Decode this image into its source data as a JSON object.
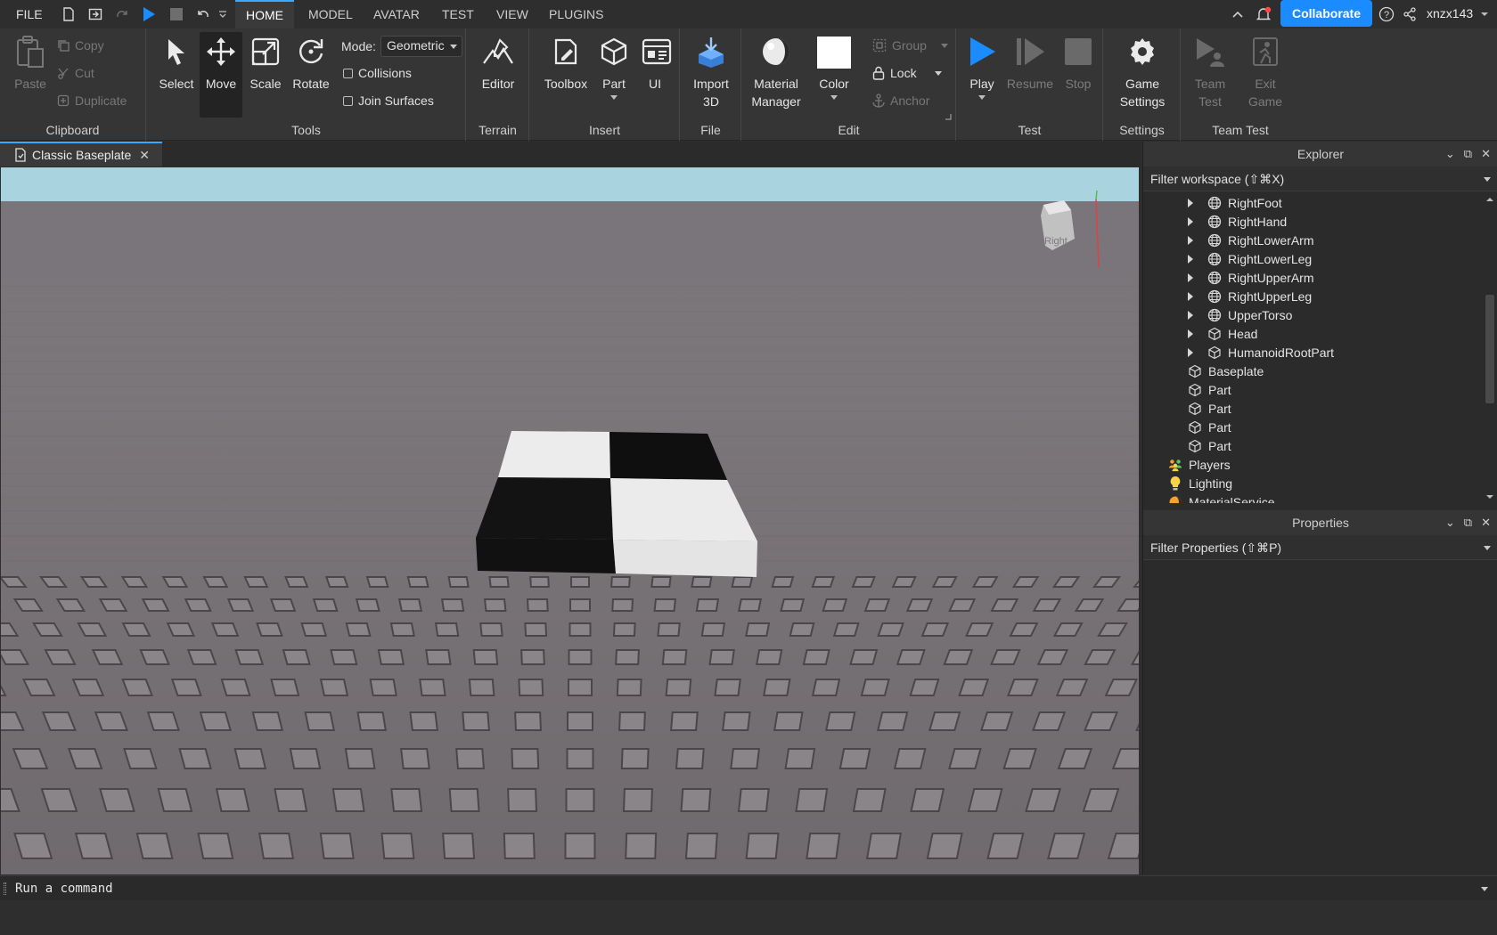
{
  "menubar": {
    "file": "FILE",
    "tabs": [
      "HOME",
      "MODEL",
      "AVATAR",
      "TEST",
      "VIEW",
      "PLUGINS"
    ],
    "active_tab": "HOME",
    "collaborate": "Collaborate",
    "username": "xnzx143"
  },
  "ribbon": {
    "clipboard": {
      "paste": "Paste",
      "copy": "Copy",
      "cut": "Cut",
      "duplicate": "Duplicate",
      "label": "Clipboard"
    },
    "tools": {
      "select": "Select",
      "move": "Move",
      "scale": "Scale",
      "rotate": "Rotate",
      "mode_label": "Mode:",
      "mode_value": "Geometric",
      "collisions": "Collisions",
      "join_surfaces": "Join Surfaces",
      "label": "Tools"
    },
    "terrain": {
      "editor": "Editor",
      "label": "Terrain"
    },
    "insert": {
      "toolbox": "Toolbox",
      "part": "Part",
      "ui": "UI",
      "label": "Insert"
    },
    "file": {
      "import3d_line1": "Import",
      "import3d_line2": "3D",
      "label": "File"
    },
    "edit": {
      "material_line1": "Material",
      "material_line2": "Manager",
      "color": "Color",
      "group": "Group",
      "lock": "Lock",
      "anchor": "Anchor",
      "label": "Edit"
    },
    "test": {
      "play": "Play",
      "resume": "Resume",
      "stop": "Stop",
      "label": "Test"
    },
    "settings": {
      "game_line1": "Game",
      "game_line2": "Settings",
      "label": "Settings"
    },
    "team_test": {
      "team_line1": "Team",
      "team_line2": "Test",
      "exit_line1": "Exit",
      "exit_line2": "Game",
      "label": "Team Test"
    }
  },
  "document": {
    "tab_title": "Classic Baseplate"
  },
  "viewport": {
    "viewcube_face": "Right"
  },
  "explorer": {
    "title": "Explorer",
    "filter_placeholder": "Filter workspace (⇧⌘X)",
    "items": [
      {
        "label": "RightFoot",
        "icon": "meshpart-icon",
        "depth": 2,
        "expandable": true
      },
      {
        "label": "RightHand",
        "icon": "meshpart-icon",
        "depth": 2,
        "expandable": true
      },
      {
        "label": "RightLowerArm",
        "icon": "meshpart-icon",
        "depth": 2,
        "expandable": true
      },
      {
        "label": "RightLowerLeg",
        "icon": "meshpart-icon",
        "depth": 2,
        "expandable": true
      },
      {
        "label": "RightUpperArm",
        "icon": "meshpart-icon",
        "depth": 2,
        "expandable": true
      },
      {
        "label": "RightUpperLeg",
        "icon": "meshpart-icon",
        "depth": 2,
        "expandable": true
      },
      {
        "label": "UpperTorso",
        "icon": "meshpart-icon",
        "depth": 2,
        "expandable": true
      },
      {
        "label": "Head",
        "icon": "part-icon",
        "depth": 2,
        "expandable": true
      },
      {
        "label": "HumanoidRootPart",
        "icon": "part-icon",
        "depth": 2,
        "expandable": true
      },
      {
        "label": "Baseplate",
        "icon": "part-icon",
        "depth": 1,
        "expandable": false
      },
      {
        "label": "Part",
        "icon": "part-icon",
        "depth": 1,
        "expandable": false
      },
      {
        "label": "Part",
        "icon": "part-icon",
        "depth": 1,
        "expandable": false
      },
      {
        "label": "Part",
        "icon": "part-icon",
        "depth": 1,
        "expandable": false
      },
      {
        "label": "Part",
        "icon": "part-icon",
        "depth": 1,
        "expandable": false
      },
      {
        "label": "Players",
        "icon": "players-icon",
        "depth": 0,
        "expandable": false
      },
      {
        "label": "Lighting",
        "icon": "lighting-icon",
        "depth": 0,
        "expandable": false
      },
      {
        "label": "MaterialService",
        "icon": "material-service-icon",
        "depth": 0,
        "expandable": false
      }
    ]
  },
  "properties": {
    "title": "Properties",
    "filter_placeholder": "Filter Properties (⇧⌘P)"
  },
  "command_bar": {
    "placeholder": "Run a command"
  },
  "colors": {
    "accent": "#1a8cff",
    "tab_underline": "#3ba8ff",
    "sky": "#a9d3de",
    "ground": "#7a7678"
  }
}
